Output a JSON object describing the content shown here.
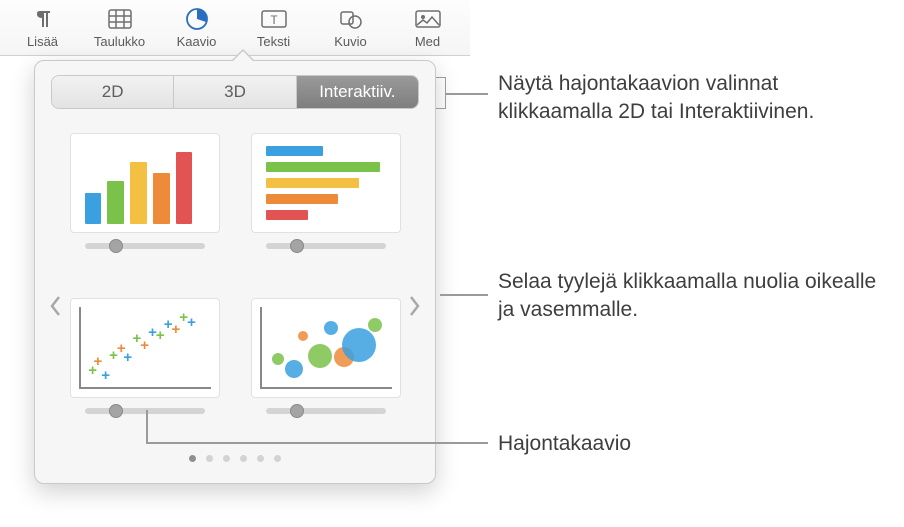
{
  "toolbar": {
    "items": [
      {
        "label": "Lisää",
        "icon": "paragraph-icon"
      },
      {
        "label": "Taulukko",
        "icon": "table-icon"
      },
      {
        "label": "Kaavio",
        "icon": "chart-icon",
        "active": true
      },
      {
        "label": "Teksti",
        "icon": "textbox-icon"
      },
      {
        "label": "Kuvio",
        "icon": "shape-icon"
      },
      {
        "label": "Med",
        "icon": "media-icon"
      }
    ]
  },
  "popover": {
    "tabs": [
      {
        "label": "2D",
        "selected": false
      },
      {
        "label": "3D",
        "selected": false
      },
      {
        "label": "Interaktiiv.",
        "selected": true
      }
    ],
    "thumbs": {
      "bar_vertical": {
        "name": "interactive-column-chart"
      },
      "bar_horizontal": {
        "name": "interactive-bar-chart"
      },
      "scatter": {
        "name": "interactive-scatter-chart"
      },
      "bubble": {
        "name": "interactive-bubble-chart"
      }
    },
    "page_dots": {
      "count": 6,
      "active": 0
    }
  },
  "annotations": {
    "tabs_hint": "Näytä hajontakaavion valinnat klikkaamalla 2D tai Interaktiivinen.",
    "arrows_hint": "Selaa tyylejä klikkaamalla nuolia oikealle ja vasemmalle.",
    "scatter_label": "Hajontakaavio"
  }
}
